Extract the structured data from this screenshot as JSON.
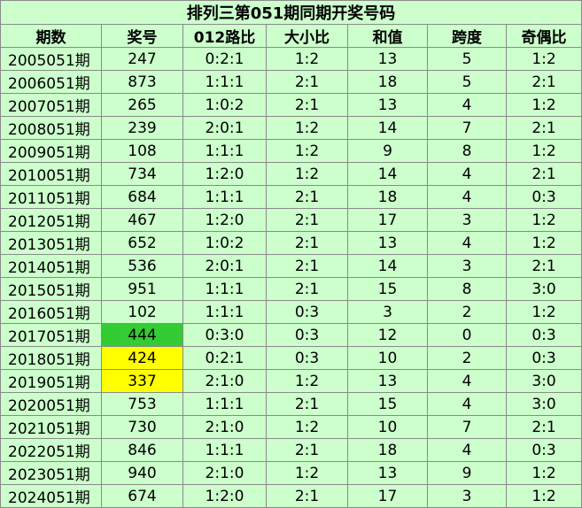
{
  "title": "排列三第051期同期开奖号码",
  "colors": {
    "row_background": "#ccffcc",
    "highlight_green": "#33cc33",
    "highlight_yellow": "#ffff00",
    "border": "#8a8a8a"
  },
  "headers": [
    "期数",
    "奖号",
    "012路比",
    "大小比",
    "和值",
    "跨度",
    "奇偶比"
  ],
  "rows": [
    {
      "period": "2005051期",
      "number": "247",
      "road012": "0:2:1",
      "size": "1:2",
      "sum": "13",
      "span": "5",
      "parity": "1:2",
      "highlight": ""
    },
    {
      "period": "2006051期",
      "number": "873",
      "road012": "1:1:1",
      "size": "2:1",
      "sum": "18",
      "span": "5",
      "parity": "2:1",
      "highlight": ""
    },
    {
      "period": "2007051期",
      "number": "265",
      "road012": "1:0:2",
      "size": "2:1",
      "sum": "13",
      "span": "4",
      "parity": "1:2",
      "highlight": ""
    },
    {
      "period": "2008051期",
      "number": "239",
      "road012": "2:0:1",
      "size": "1:2",
      "sum": "14",
      "span": "7",
      "parity": "2:1",
      "highlight": ""
    },
    {
      "period": "2009051期",
      "number": "108",
      "road012": "1:1:1",
      "size": "1:2",
      "sum": "9",
      "span": "8",
      "parity": "1:2",
      "highlight": ""
    },
    {
      "period": "2010051期",
      "number": "734",
      "road012": "1:2:0",
      "size": "1:2",
      "sum": "14",
      "span": "4",
      "parity": "2:1",
      "highlight": ""
    },
    {
      "period": "2011051期",
      "number": "684",
      "road012": "1:1:1",
      "size": "2:1",
      "sum": "18",
      "span": "4",
      "parity": "0:3",
      "highlight": ""
    },
    {
      "period": "2012051期",
      "number": "467",
      "road012": "1:2:0",
      "size": "2:1",
      "sum": "17",
      "span": "3",
      "parity": "1:2",
      "highlight": ""
    },
    {
      "period": "2013051期",
      "number": "652",
      "road012": "1:0:2",
      "size": "2:1",
      "sum": "13",
      "span": "4",
      "parity": "1:2",
      "highlight": ""
    },
    {
      "period": "2014051期",
      "number": "536",
      "road012": "2:0:1",
      "size": "2:1",
      "sum": "14",
      "span": "3",
      "parity": "2:1",
      "highlight": ""
    },
    {
      "period": "2015051期",
      "number": "951",
      "road012": "1:1:1",
      "size": "2:1",
      "sum": "15",
      "span": "8",
      "parity": "3:0",
      "highlight": ""
    },
    {
      "period": "2016051期",
      "number": "102",
      "road012": "1:1:1",
      "size": "0:3",
      "sum": "3",
      "span": "2",
      "parity": "1:2",
      "highlight": ""
    },
    {
      "period": "2017051期",
      "number": "444",
      "road012": "0:3:0",
      "size": "0:3",
      "sum": "12",
      "span": "0",
      "parity": "0:3",
      "highlight": "green"
    },
    {
      "period": "2018051期",
      "number": "424",
      "road012": "0:2:1",
      "size": "0:3",
      "sum": "10",
      "span": "2",
      "parity": "0:3",
      "highlight": "yellow"
    },
    {
      "period": "2019051期",
      "number": "337",
      "road012": "2:1:0",
      "size": "1:2",
      "sum": "13",
      "span": "4",
      "parity": "3:0",
      "highlight": "yellow"
    },
    {
      "period": "2020051期",
      "number": "753",
      "road012": "1:1:1",
      "size": "2:1",
      "sum": "15",
      "span": "4",
      "parity": "3:0",
      "highlight": ""
    },
    {
      "period": "2021051期",
      "number": "730",
      "road012": "2:1:0",
      "size": "1:2",
      "sum": "10",
      "span": "7",
      "parity": "2:1",
      "highlight": ""
    },
    {
      "period": "2022051期",
      "number": "846",
      "road012": "1:1:1",
      "size": "2:1",
      "sum": "18",
      "span": "4",
      "parity": "0:3",
      "highlight": ""
    },
    {
      "period": "2023051期",
      "number": "940",
      "road012": "2:1:0",
      "size": "1:2",
      "sum": "13",
      "span": "9",
      "parity": "1:2",
      "highlight": ""
    },
    {
      "period": "2024051期",
      "number": "674",
      "road012": "1:2:0",
      "size": "2:1",
      "sum": "17",
      "span": "3",
      "parity": "1:2",
      "highlight": ""
    }
  ]
}
